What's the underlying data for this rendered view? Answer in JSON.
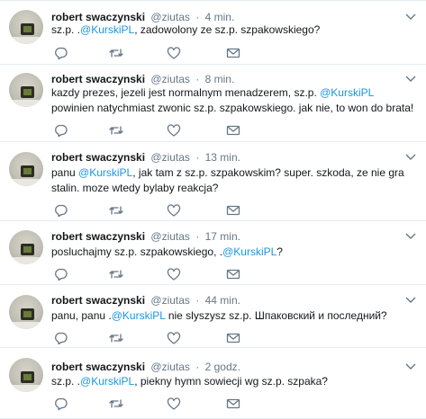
{
  "colors": {
    "text": "#14171a",
    "secondary": "#657786",
    "mention": "#1b95e0",
    "divider": "#e6ecf0",
    "icon": "#657786"
  },
  "icons": {
    "reply": "reply-icon",
    "retweet": "retweet-icon",
    "like": "heart-icon",
    "message": "envelope-icon",
    "more": "chevron-down-icon"
  },
  "tweets": [
    {
      "name": "robert swaczynski",
      "handle": "@ziutas",
      "separator": "·",
      "time": "4 min.",
      "parts": [
        "sz.p. .",
        "@KurskiPL",
        ", zadowolony ze sz.p. szpakowskiego?"
      ]
    },
    {
      "name": "robert swaczynski",
      "handle": "@ziutas",
      "separator": "·",
      "time": "8 min.",
      "parts": [
        "kazdy prezes, jezeli jest normalnym menadzerem, sz.p. ",
        "@KurskiPL",
        " powinien natychmiast zwonic sz.p. szpakowskiego. jak nie, to won do brata!"
      ]
    },
    {
      "name": "robert swaczynski",
      "handle": "@ziutas",
      "separator": "·",
      "time": "13 min.",
      "parts": [
        "panu ",
        "@KurskiPL",
        ", jak tam z sz.p. szpakowskim? super. szkoda, ze nie gra stalin. moze wtedy bylaby reakcja?"
      ]
    },
    {
      "name": "robert swaczynski",
      "handle": "@ziutas",
      "separator": "·",
      "time": "17 min.",
      "parts": [
        "posluchajmy sz.p. szpakowskiego, .",
        "@KurskiPL",
        "?"
      ]
    },
    {
      "name": "robert swaczynski",
      "handle": "@ziutas",
      "separator": "·",
      "time": "44 min.",
      "parts": [
        "panu, panu .",
        "@KurskiPL",
        " nie slyszysz sz.p. Шпаковский и последний?"
      ]
    },
    {
      "name": "robert swaczynski",
      "handle": "@ziutas",
      "separator": "·",
      "time": "2 godz.",
      "parts": [
        "sz.p. .",
        "@KurskiPL",
        ", piekny hymn sowiecji wg sz.p. szpaka?"
      ]
    }
  ]
}
